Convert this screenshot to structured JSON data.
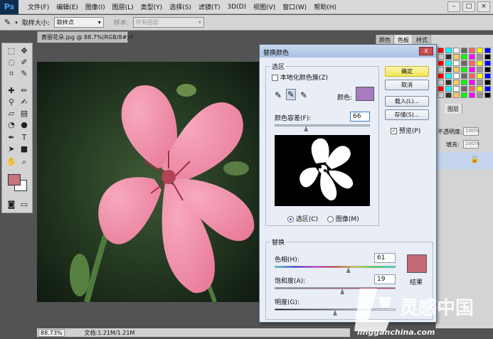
{
  "app": {
    "logo": "Ps"
  },
  "menubar": {
    "items": [
      "文件(F)",
      "编辑(E)",
      "图像(I)",
      "图层(L)",
      "类型(Y)",
      "选择(S)",
      "滤镜(T)",
      "3D(D)",
      "视图(V)",
      "窗口(W)",
      "帮助(H)"
    ]
  },
  "window_controls": {
    "minimize": "–",
    "maximize": "□",
    "close": "×"
  },
  "options_bar": {
    "sample_size_label": "取样大小:",
    "sample_size_value": "取样点",
    "sample_label": "样本:",
    "sample_value": "所有图层"
  },
  "document": {
    "tab_title": "黄丽花朵.jpg @ 88.7%(RGB/8#)",
    "tab_close": "×"
  },
  "status": {
    "zoom": "88.73%",
    "doc_size": "文档:1.21M/1.21M"
  },
  "swatch_panel": {
    "tabs": [
      "颜色",
      "色板",
      "样式"
    ]
  },
  "layers_panel": {
    "tabs": [
      "图层"
    ],
    "opacity_label": "不透明度:",
    "opacity_value": "100%",
    "fill_label": "填充:",
    "fill_value": "100%"
  },
  "dialog": {
    "title": "替换颜色",
    "close": "x",
    "selection": {
      "legend": "选区",
      "localized_label": "本地化颜色簇(Z)",
      "localized_checked": false,
      "color_label": "颜色:",
      "color_swatch": "#a97bc0",
      "fuzziness_label": "颜色容差(F):",
      "fuzziness_value": "66",
      "fuzziness_fraction": 0.33,
      "view_selection_label": "选区(C)",
      "view_image_label": "图像(M)"
    },
    "buttons": {
      "ok": "确定",
      "cancel": "取消",
      "load": "载入(L)...",
      "save": "存储(S)..."
    },
    "preview": {
      "label": "预览(P)",
      "checked": true
    },
    "replacement": {
      "legend": "替换",
      "hue_label": "色相(H):",
      "hue_value": "61",
      "hue_fraction": 0.61,
      "saturation_label": "饱和度(A):",
      "saturation_value": "19",
      "saturation_fraction": 0.56,
      "lightness_label": "明度(G):",
      "lightness_fraction": 0.5,
      "result_label": "结果",
      "result_swatch": "#c66a78"
    }
  },
  "colors": {
    "foreground": "#c7757f",
    "background": "#ffffff",
    "ok_highlight": "#f5e94a"
  },
  "watermark": {
    "brand": "灵感中国",
    "url": "lingganchina.com"
  }
}
